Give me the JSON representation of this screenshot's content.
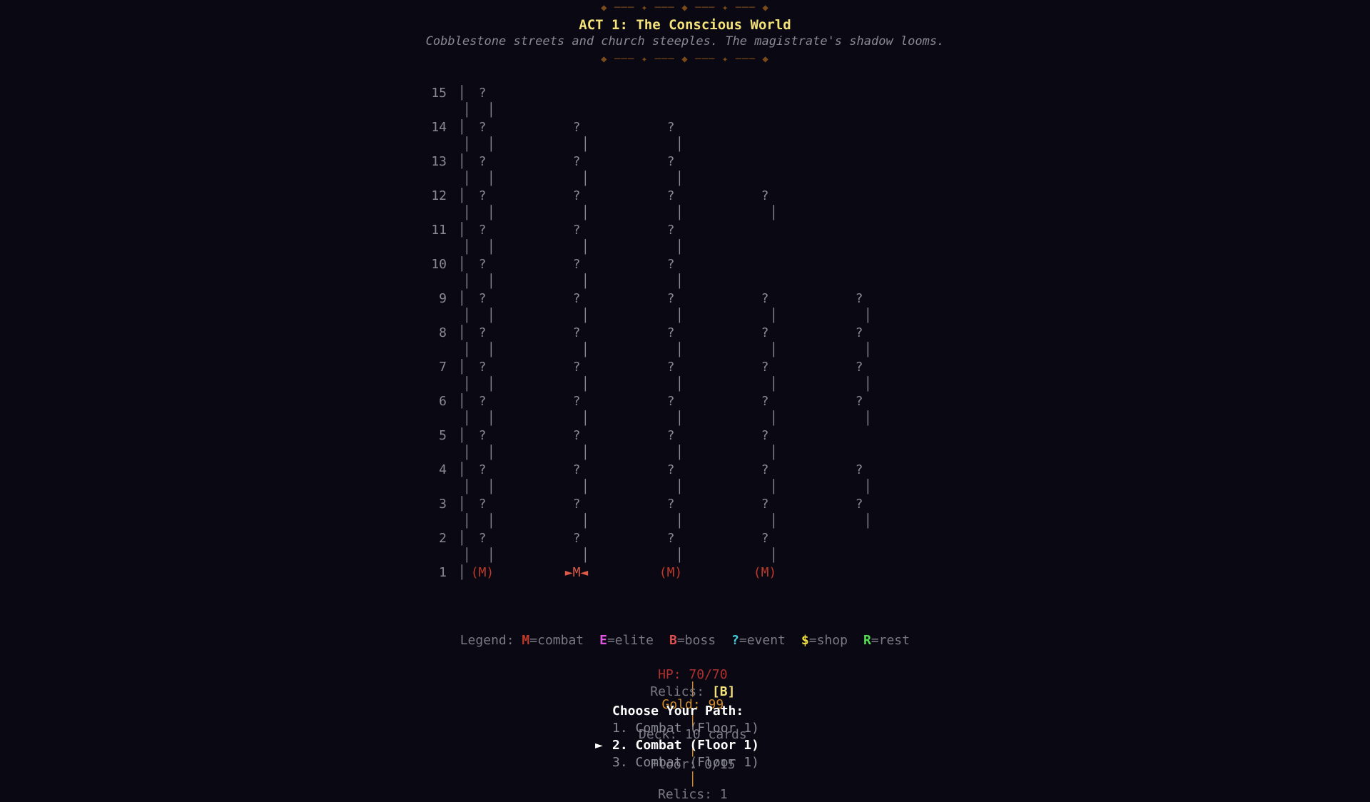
{
  "header": {
    "decor": "◆ ─── ✦ ─── ◆ ─── ✦ ─── ◆",
    "title": "ACT 1: The Conscious World",
    "subtitle": "Cobblestone streets and church steeples. The magistrate's shadow looms."
  },
  "map": {
    "rows": [
      {
        "num": "15",
        "nodes": [
          {
            "col": 0,
            "label": "?"
          }
        ],
        "links": [
          0
        ]
      },
      {
        "num": "14",
        "nodes": [
          {
            "col": 0,
            "label": "?"
          },
          {
            "col": 1,
            "label": "?"
          },
          {
            "col": 2,
            "label": "?"
          }
        ],
        "links": [
          0,
          1,
          2
        ]
      },
      {
        "num": "13",
        "nodes": [
          {
            "col": 0,
            "label": "?"
          },
          {
            "col": 1,
            "label": "?"
          },
          {
            "col": 2,
            "label": "?"
          }
        ],
        "links": [
          0,
          1,
          2
        ]
      },
      {
        "num": "12",
        "nodes": [
          {
            "col": 0,
            "label": "?"
          },
          {
            "col": 1,
            "label": "?"
          },
          {
            "col": 2,
            "label": "?"
          },
          {
            "col": 3,
            "label": "?"
          }
        ],
        "links": [
          0,
          1,
          2,
          3
        ]
      },
      {
        "num": "11",
        "nodes": [
          {
            "col": 0,
            "label": "?"
          },
          {
            "col": 1,
            "label": "?"
          },
          {
            "col": 2,
            "label": "?"
          }
        ],
        "links": [
          0,
          1,
          2
        ]
      },
      {
        "num": "10",
        "nodes": [
          {
            "col": 0,
            "label": "?"
          },
          {
            "col": 1,
            "label": "?"
          },
          {
            "col": 2,
            "label": "?"
          }
        ],
        "links": [
          0,
          1,
          2
        ]
      },
      {
        "num": "9",
        "nodes": [
          {
            "col": 0,
            "label": "?"
          },
          {
            "col": 1,
            "label": "?"
          },
          {
            "col": 2,
            "label": "?"
          },
          {
            "col": 3,
            "label": "?"
          },
          {
            "col": 4,
            "label": "?"
          }
        ],
        "links": [
          0,
          1,
          2,
          3,
          4
        ]
      },
      {
        "num": "8",
        "nodes": [
          {
            "col": 0,
            "label": "?"
          },
          {
            "col": 1,
            "label": "?"
          },
          {
            "col": 2,
            "label": "?"
          },
          {
            "col": 3,
            "label": "?"
          },
          {
            "col": 4,
            "label": "?"
          }
        ],
        "links": [
          0,
          1,
          2,
          3,
          4
        ]
      },
      {
        "num": "7",
        "nodes": [
          {
            "col": 0,
            "label": "?"
          },
          {
            "col": 1,
            "label": "?"
          },
          {
            "col": 2,
            "label": "?"
          },
          {
            "col": 3,
            "label": "?"
          },
          {
            "col": 4,
            "label": "?"
          }
        ],
        "links": [
          0,
          1,
          2,
          3,
          4
        ]
      },
      {
        "num": "6",
        "nodes": [
          {
            "col": 0,
            "label": "?"
          },
          {
            "col": 1,
            "label": "?"
          },
          {
            "col": 2,
            "label": "?"
          },
          {
            "col": 3,
            "label": "?"
          },
          {
            "col": 4,
            "label": "?"
          }
        ],
        "links": [
          0,
          1,
          2,
          3,
          4
        ]
      },
      {
        "num": "5",
        "nodes": [
          {
            "col": 0,
            "label": "?"
          },
          {
            "col": 1,
            "label": "?"
          },
          {
            "col": 2,
            "label": "?"
          },
          {
            "col": 3,
            "label": "?"
          }
        ],
        "links": [
          0,
          1,
          2,
          3
        ]
      },
      {
        "num": "4",
        "nodes": [
          {
            "col": 0,
            "label": "?"
          },
          {
            "col": 1,
            "label": "?"
          },
          {
            "col": 2,
            "label": "?"
          },
          {
            "col": 3,
            "label": "?"
          },
          {
            "col": 4,
            "label": "?"
          }
        ],
        "links": [
          0,
          1,
          2,
          3,
          4
        ]
      },
      {
        "num": "3",
        "nodes": [
          {
            "col": 0,
            "label": "?"
          },
          {
            "col": 1,
            "label": "?"
          },
          {
            "col": 2,
            "label": "?"
          },
          {
            "col": 3,
            "label": "?"
          },
          {
            "col": 4,
            "label": "?"
          }
        ],
        "links": [
          0,
          1,
          2,
          3,
          4
        ]
      },
      {
        "num": "2",
        "nodes": [
          {
            "col": 0,
            "label": "?"
          },
          {
            "col": 1,
            "label": "?"
          },
          {
            "col": 2,
            "label": "?"
          },
          {
            "col": 3,
            "label": "?"
          }
        ],
        "links": [
          0,
          1,
          2,
          3
        ]
      },
      {
        "num": "1",
        "nodes": [
          {
            "col": 0,
            "label": "(M)",
            "type": "combat"
          },
          {
            "col": 1,
            "label": "►M◄",
            "type": "selected"
          },
          {
            "col": 2,
            "label": "(M)",
            "type": "combat"
          },
          {
            "col": 3,
            "label": "(M)",
            "type": "combat"
          }
        ],
        "links": []
      }
    ]
  },
  "legend": {
    "prefix": "Legend: ",
    "items": [
      {
        "key": "M",
        "text": "=combat",
        "color": "#c0392b"
      },
      {
        "key": "E",
        "text": "=elite",
        "color": "#e056e0"
      },
      {
        "key": "B",
        "text": "=boss",
        "color": "#e05050"
      },
      {
        "key": "?",
        "text": "=event",
        "color": "#40d0e0"
      },
      {
        "key": "$",
        "text": "=shop",
        "color": "#f0e040"
      },
      {
        "key": "R",
        "text": "=rest",
        "color": "#50e050"
      }
    ]
  },
  "stats": {
    "hp": "HP: 70/70",
    "gold": "Gold: 99",
    "deck": "Deck: 10 cards",
    "floor": "Floor: 0/15",
    "relics": "Relics: 1",
    "sep": "│",
    "hp_color": "#b03030",
    "gold_color": "#d08a2a",
    "sep_color": "#d08a2a"
  },
  "relics_line": {
    "label": "Relics: ",
    "value": "[B]"
  },
  "path": {
    "heading": "Choose Your Path:",
    "cursor": "►",
    "options": [
      {
        "text": "1. Combat (Floor 1)",
        "active": false
      },
      {
        "text": "2. Combat (Floor 1)",
        "active": true
      },
      {
        "text": "3. Combat (Floor 1)",
        "active": false
      }
    ]
  }
}
